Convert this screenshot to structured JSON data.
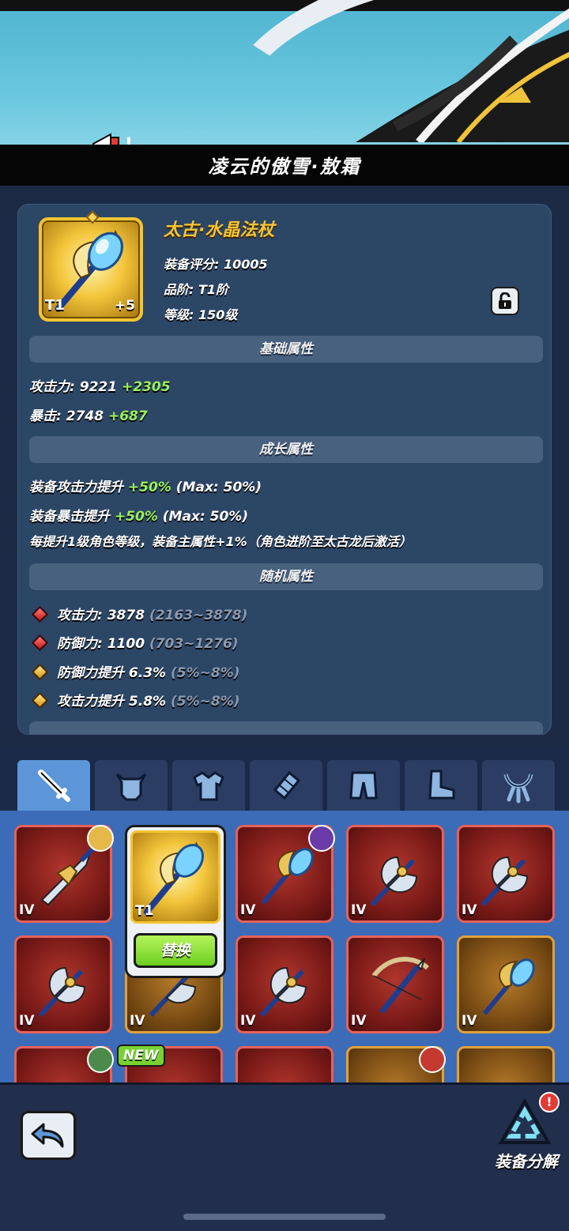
{
  "banner": {
    "title": "凌云的傲雪·敖霜"
  },
  "item": {
    "name": "太古·水晶法杖",
    "score": "装备评分: 10005",
    "grade": "品阶: T1阶",
    "level": "等级: 150级",
    "tier_badge": "T1",
    "plus_badge": "+5"
  },
  "sections": {
    "basic": "基础属性",
    "growth": "成长属性",
    "random": "随机属性"
  },
  "basic_stats": [
    {
      "label": "攻击力:",
      "value": "9221",
      "bonus": "+2305"
    },
    {
      "label": "暴击:",
      "value": "2748",
      "bonus": "+687"
    }
  ],
  "growth_stats": [
    {
      "label": "装备攻击力提升",
      "bonus": "+50%",
      "max": "(Max: 50%)"
    },
    {
      "label": "装备暴击提升",
      "bonus": "+50%",
      "max": "(Max: 50%)"
    },
    {
      "text": "每提升1级角色等级，装备主属性+1%（角色进阶至太古龙后激活）"
    }
  ],
  "random_stats": [
    {
      "label": "攻击力: 3878",
      "range": "(2163~3878)",
      "gem": "red"
    },
    {
      "label": "防御力: 1100",
      "range": "(703~1276)",
      "gem": "red"
    },
    {
      "label": "防御力提升 6.3%",
      "range": "(5%~8%)",
      "gem": "gold"
    },
    {
      "label": "攻击力提升 5.8%",
      "range": "(5%~8%)",
      "gem": "gold"
    }
  ],
  "tabs": [
    "weapon-icon",
    "helmet-icon",
    "armor-icon",
    "bracer-icon",
    "pants-icon",
    "boots-icon",
    "necklace-icon"
  ],
  "grid": {
    "tier_label": "IV",
    "selected_tier": "T1",
    "replace_label": "替换",
    "new_label": "NEW"
  },
  "footer": {
    "salvage_label": "装备分解",
    "salvage_badge": "!"
  },
  "colors": {
    "accent_gold": "#f6c535",
    "bonus_green": "#9bf05d",
    "rarity_red": "#e5625a",
    "rarity_gold": "#e1a23a"
  }
}
